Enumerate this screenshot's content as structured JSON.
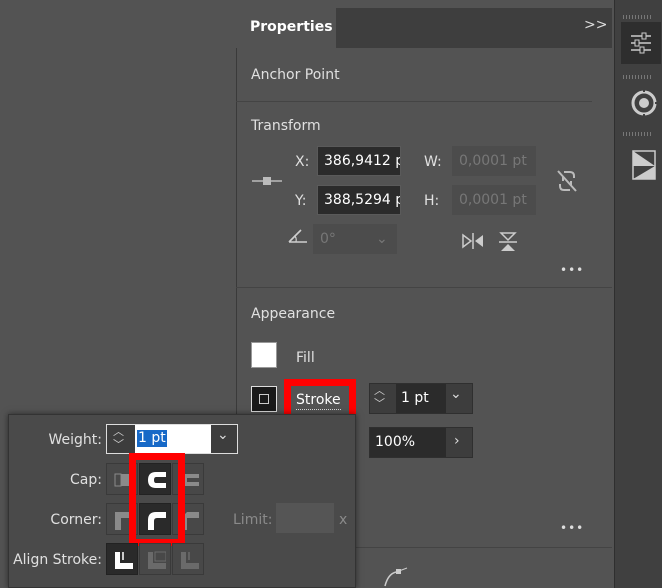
{
  "panel": {
    "tab_label": "Properties",
    "collapse_glyph": ">>",
    "anchor_point_title": "Anchor Point",
    "transform": {
      "title": "Transform",
      "x_label": "X:",
      "x_value": "386,9412 p",
      "y_label": "Y:",
      "y_value": "388,5294 p",
      "w_label": "W:",
      "w_value": "0,0001 pt",
      "h_label": "H:",
      "h_value": "0,0001 pt",
      "angle_value": "0°",
      "more_glyph": "•••"
    },
    "appearance": {
      "title": "Appearance",
      "fill_label": "Fill",
      "stroke_label": "Stroke",
      "stroke_weight": "1 pt",
      "opacity_value": "100%",
      "more_glyph": "•••",
      "fill_color": "#ffffff",
      "highlight_color": "#ff0000"
    }
  },
  "stroke_popup": {
    "weight_label": "Weight:",
    "weight_value": "1 pt",
    "cap_label": "Cap:",
    "corner_label": "Corner:",
    "limit_label": "Limit:",
    "limit_suffix": "x",
    "align_label": "Align Stroke:"
  },
  "icons": [
    "anchor-icon",
    "link-icon",
    "angle-icon",
    "flip-horizontal-icon",
    "flip-vertical-icon",
    "properties-sliders-icon",
    "color-wheel-icon",
    "gradient-swatch-icon",
    "butt-cap-icon",
    "round-cap-icon",
    "projecting-cap-icon",
    "miter-join-icon",
    "round-join-icon",
    "bevel-join-icon",
    "align-center-icon",
    "align-inside-icon",
    "align-outside-icon"
  ]
}
